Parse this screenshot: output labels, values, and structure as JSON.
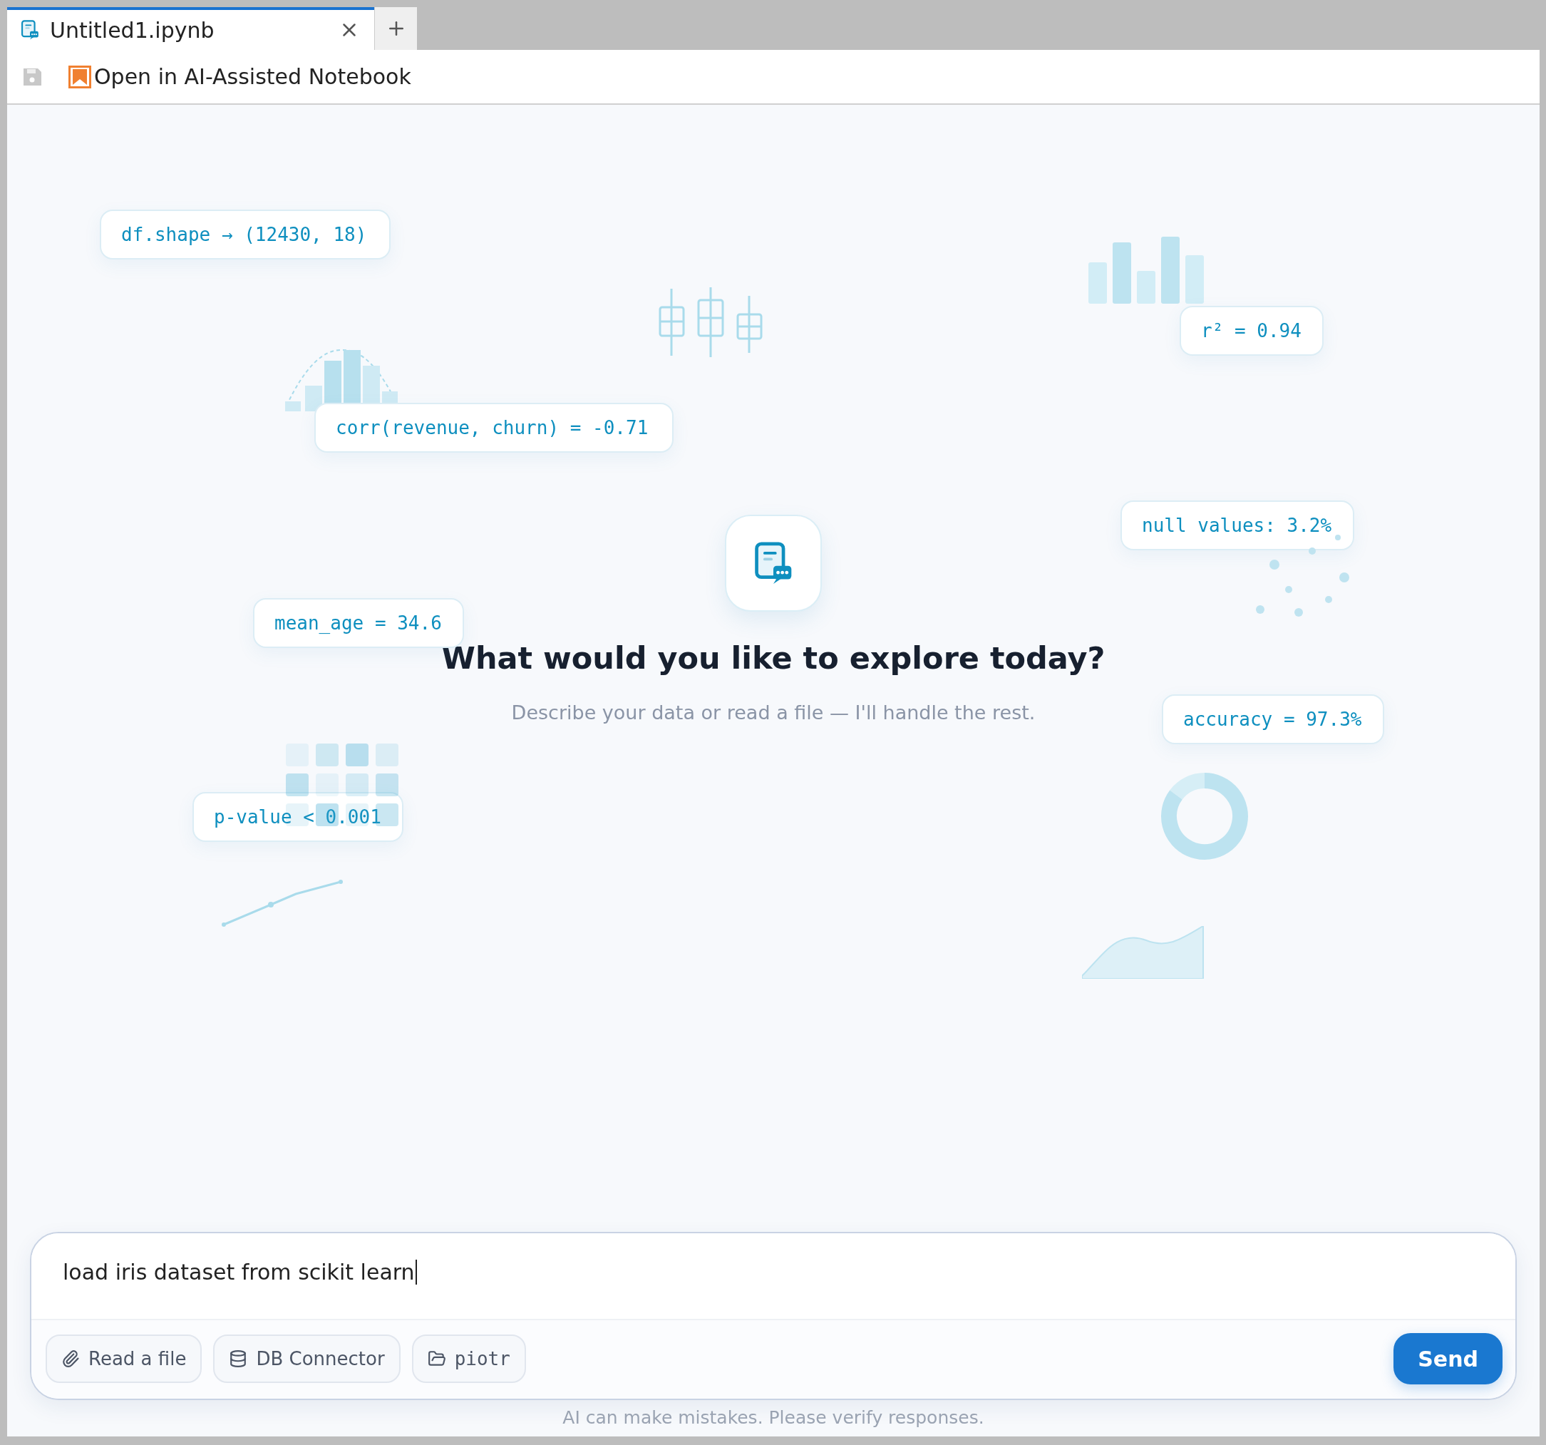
{
  "tabs": [
    {
      "label": "Untitled1.ipynb",
      "selected": true
    }
  ],
  "toolbar": {
    "open_button": "Open in AI-Assisted Notebook"
  },
  "chips": [
    "df.shape → (12430, 18)",
    "r² = 0.94",
    "corr(revenue, churn) = -0.71",
    "null values: 3.2%",
    "mean_age = 34.6",
    "accuracy = 97.3%",
    "p-value < 0.001"
  ],
  "hero": {
    "title": "What would you like to explore today?",
    "subtitle": "Describe your data or read a file — I'll handle the rest."
  },
  "composer": {
    "value": "load iris dataset from scikit learn",
    "tools": [
      {
        "label": "Read a file",
        "kind": "attach"
      },
      {
        "label": "DB Connector",
        "kind": "database"
      },
      {
        "label": "piotr",
        "kind": "folder"
      }
    ],
    "send": "Send"
  },
  "footer": "AI can make mistakes. Please verify responses."
}
